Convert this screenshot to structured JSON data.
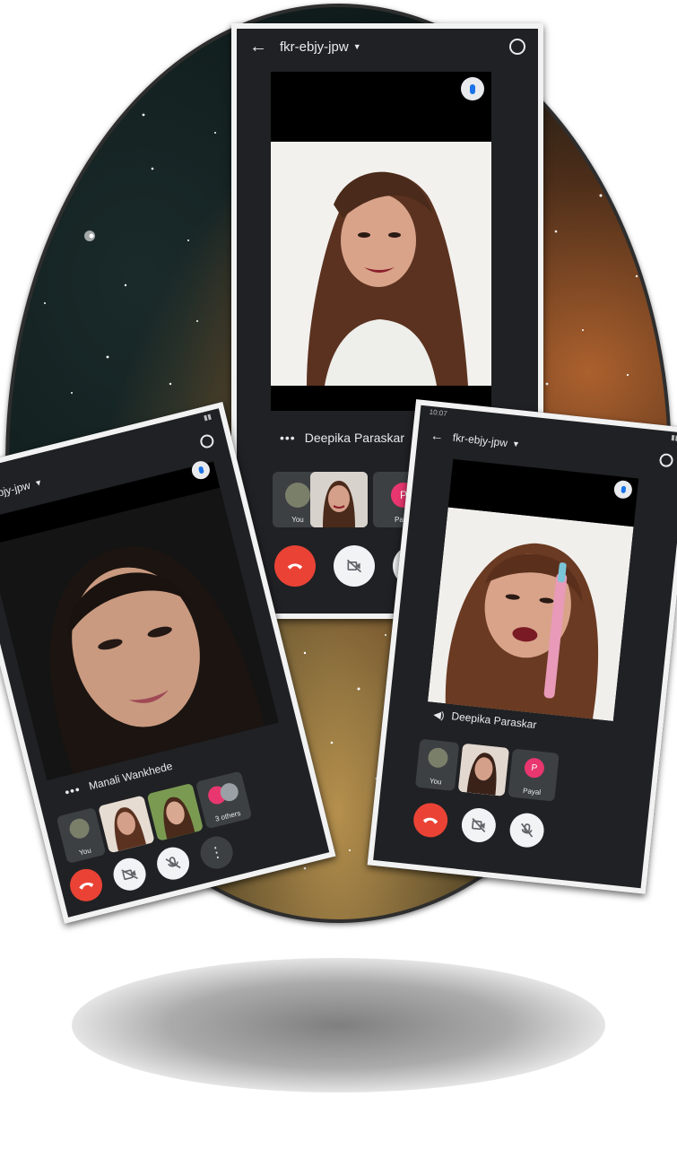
{
  "center_phone": {
    "meeting_code": "fkr-ebjy-jpw",
    "speaker_name": "Deepika Paraskar",
    "tiles": [
      {
        "label": "You"
      },
      {
        "label": ""
      },
      {
        "label": "Payal",
        "letter": "P"
      }
    ]
  },
  "left_phone": {
    "meeting_code": "fkr-ebjy-jpw",
    "speaker_name": "Manali Wankhede",
    "tiles": [
      {
        "label": "You"
      },
      {
        "label": ""
      },
      {
        "label": ""
      },
      {
        "label": "3 others"
      }
    ]
  },
  "right_phone": {
    "status_time": "10:07",
    "meeting_code": "fkr-ebjy-jpw",
    "speaker_name": "Deepika Paraskar",
    "tiles": [
      {
        "label": "You"
      },
      {
        "label": ""
      },
      {
        "label": "Payal",
        "letter": "P"
      }
    ]
  },
  "colors": {
    "end_call": "#ea4335",
    "avatar_pink": "#e8366f",
    "meet_dark": "#202124"
  },
  "icons": [
    "back-arrow-icon",
    "switch-camera-icon",
    "mic-active-icon",
    "end-call-icon",
    "camera-off-icon",
    "mic-off-icon",
    "more-options-icon"
  ]
}
